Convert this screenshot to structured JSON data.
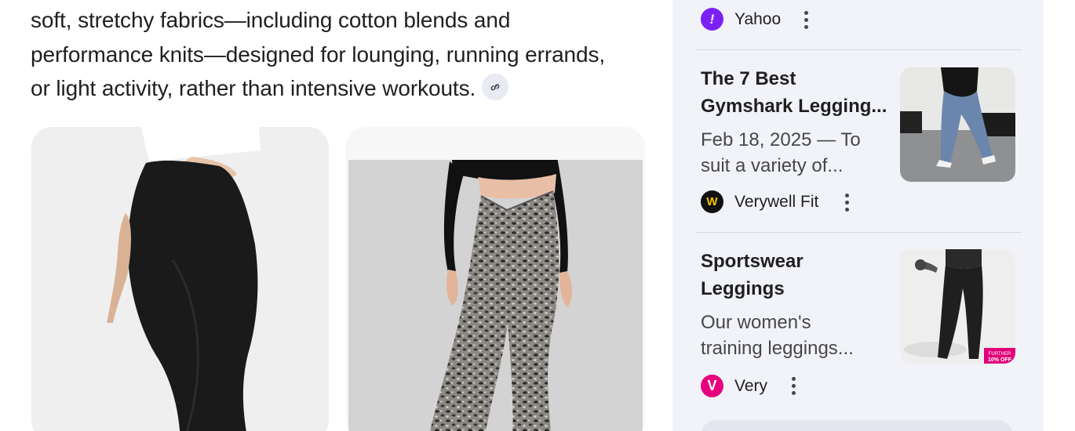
{
  "answer": {
    "lines": [
      "soft, stretchy fabrics—including cotton blends and",
      "performance knits—designed for lounging, running errands,",
      "or light activity, rather than intensive workouts."
    ]
  },
  "images": [
    {
      "alt": "Black leggings"
    },
    {
      "alt": "Leopard print cross-waist leggings"
    }
  ],
  "side": {
    "top_source": {
      "name": "Yahoo",
      "logo_glyph": "!",
      "color": "#7b21f5"
    },
    "results": [
      {
        "title_lines": [
          "The 7 Best",
          "Gymshark Legging..."
        ],
        "snippet_lines": [
          "Feb 18, 2025 — To",
          "suit a variety of..."
        ],
        "source": {
          "name": "Verywell Fit",
          "logo_glyph": "W",
          "color": "#111111"
        }
      },
      {
        "title_lines": [
          "Sportswear",
          "Leggings"
        ],
        "snippet_lines": [
          "Our women's",
          "training leggings..."
        ],
        "source": {
          "name": "Very",
          "logo_glyph": "V",
          "color": "#e6007e"
        },
        "badge_lines": [
          "FURTHER",
          "10% OFF"
        ]
      }
    ]
  },
  "icons": {
    "link": "link-icon",
    "more": "more-vertical-icon"
  }
}
